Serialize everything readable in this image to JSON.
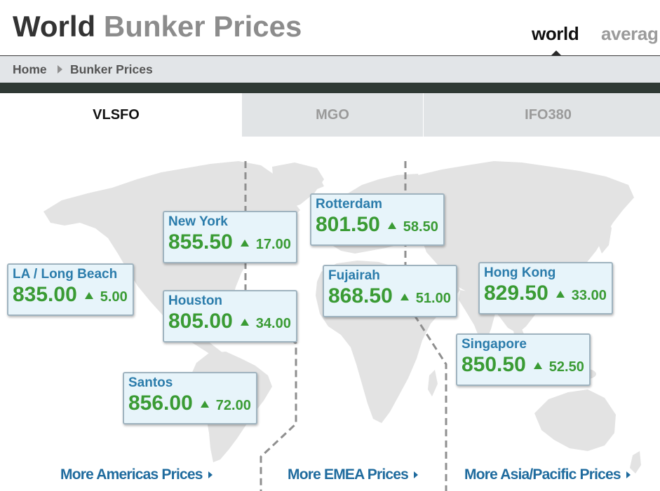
{
  "header": {
    "title_main": "World",
    "title_sub": "Bunker Prices",
    "nav": [
      {
        "label": "world",
        "active": true
      },
      {
        "label": "averag",
        "active": false
      }
    ]
  },
  "breadcrumb": {
    "items": [
      {
        "label": "Home"
      },
      {
        "label": "Bunker Prices"
      }
    ]
  },
  "tabs": [
    {
      "label": "VLSFO",
      "active": true
    },
    {
      "label": "MGO",
      "active": false
    },
    {
      "label": "IFO380",
      "active": false
    }
  ],
  "ports": [
    {
      "name": "LA / Long Beach",
      "price": "835.00",
      "change": "5.00",
      "trend_icon": "triangle-up-icon"
    },
    {
      "name": "New York",
      "price": "855.50",
      "change": "17.00",
      "trend_icon": "triangle-up-icon"
    },
    {
      "name": "Houston",
      "price": "805.00",
      "change": "34.00",
      "trend_icon": "triangle-up-icon"
    },
    {
      "name": "Santos",
      "price": "856.00",
      "change": "72.00",
      "trend_icon": "triangle-up-icon"
    },
    {
      "name": "Rotterdam",
      "price": "801.50",
      "change": "58.50",
      "trend_icon": "triangle-up-icon"
    },
    {
      "name": "Fujairah",
      "price": "868.50",
      "change": "51.00",
      "trend_icon": "triangle-up-icon"
    },
    {
      "name": "Hong Kong",
      "price": "829.50",
      "change": "33.00",
      "trend_icon": "triangle-up-icon"
    },
    {
      "name": "Singapore",
      "price": "850.50",
      "change": "52.50",
      "trend_icon": "triangle-up-icon"
    }
  ],
  "region_links": [
    {
      "label": "More Americas Prices",
      "icon": "triangle-right-icon"
    },
    {
      "label": "More EMEA Prices",
      "icon": "triangle-right-icon"
    },
    {
      "label": "More Asia/Pacific Prices",
      "icon": "triangle-right-icon"
    }
  ],
  "icons": {
    "breadcrumb_separator": "triangle-right-icon",
    "nav_indicator": "triangle-up-icon",
    "map": "world-map-icon"
  },
  "colors": {
    "title_dark": "#333333",
    "title_gray": "#8c8c8c",
    "nav_active": "#111111",
    "nav_inactive": "#9b9b9b",
    "breadcrumb_bg": "#e2e5e8",
    "breadcrumb_text": "#555555",
    "dark_bar": "#2f3934",
    "tab_inactive_bg": "#e1e4e6",
    "tab_inactive_text": "#9a9a9a",
    "card_bg": "#e7f4fa",
    "card_border": "#9fb3bf",
    "port_name": "#2b7cab",
    "price_green": "#3a9b34",
    "link_blue": "#1f6b9e",
    "map_land": "#e3e3e3",
    "divider": "#8f8f8f"
  }
}
